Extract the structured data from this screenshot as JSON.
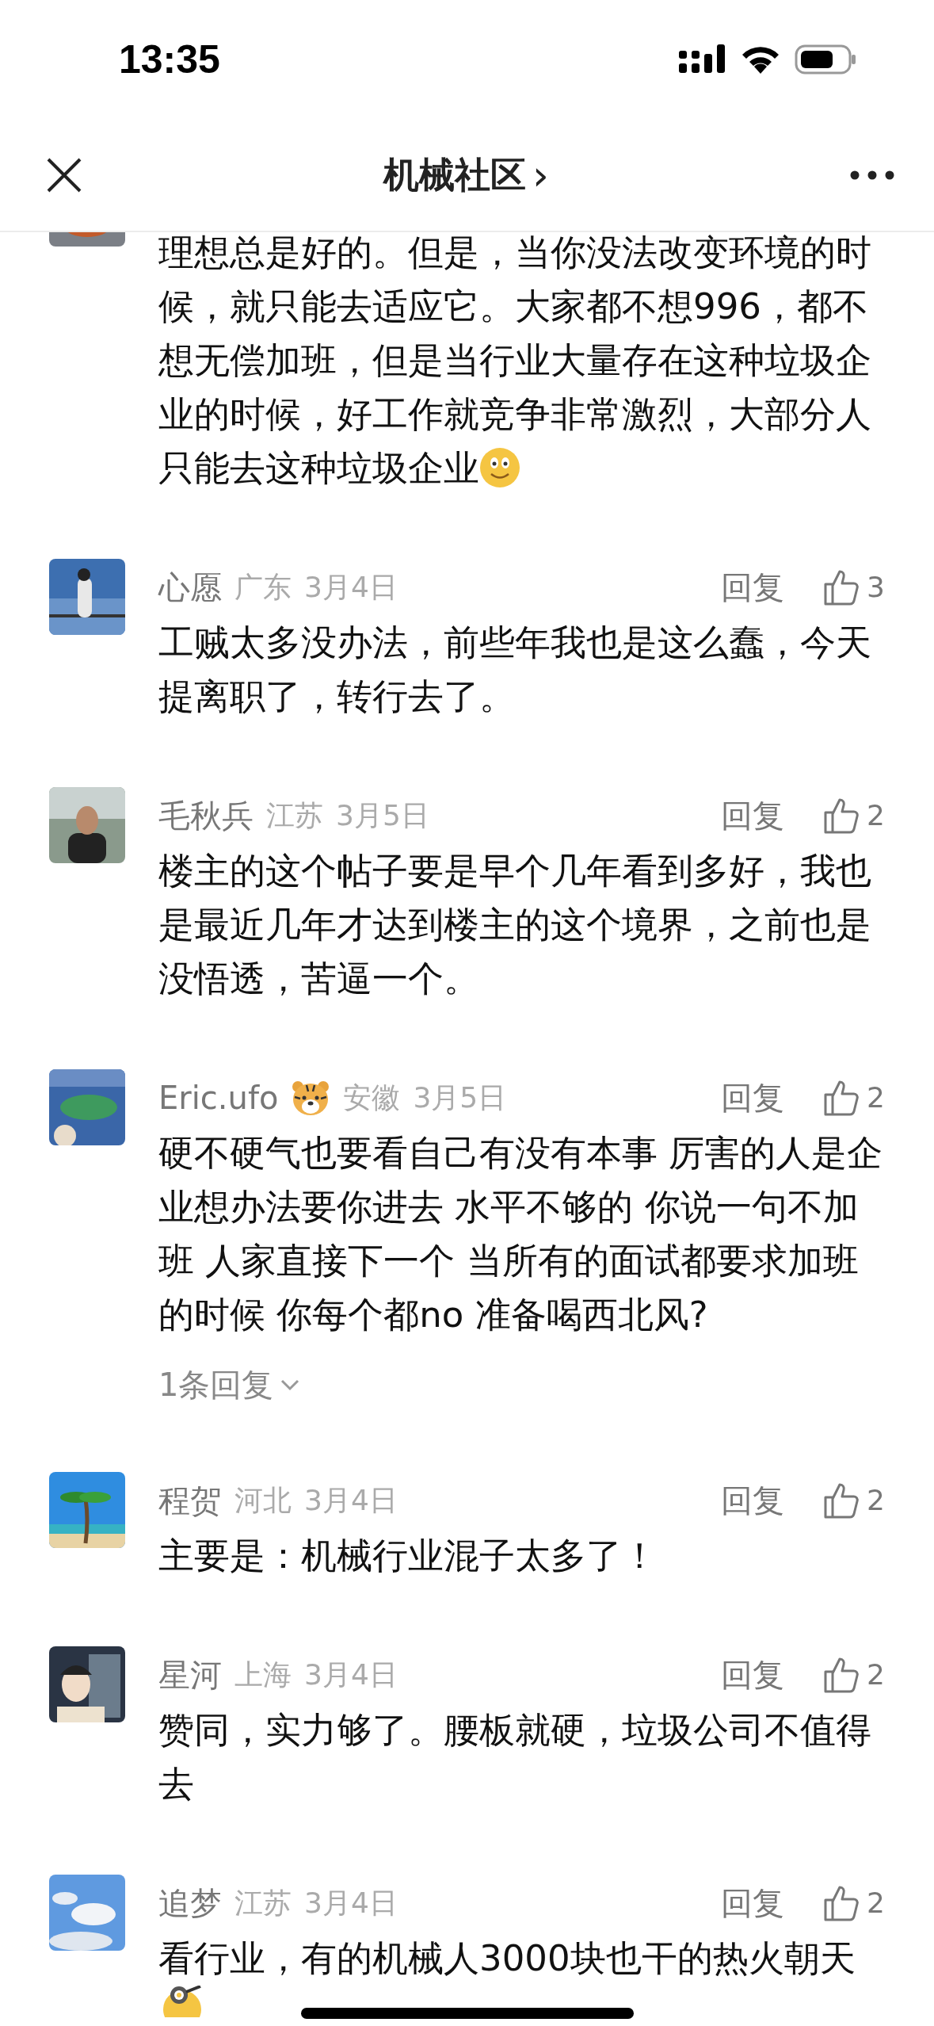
{
  "status_bar": {
    "time": "13:35"
  },
  "header": {
    "title": "机械社区",
    "chevron": "›"
  },
  "comments": [
    {
      "kind": "partial",
      "text": "理想总是好的。但是，当你没法改变环境的时候，就只能去适应它。大家都不想996，都不想无偿加班，但是当行业大量存在这种垃圾企业的时候，好工作就竞争非常激烈，大部分人只能去这种垃圾企业",
      "emoji_after_text": true
    },
    {
      "kind": "full",
      "name": "心愿",
      "region": "广东",
      "date": "3月4日",
      "reply": "回复",
      "likes": "3",
      "text": "工贼太多没办法，前些年我也是这么蠢，今天提离职了，转行去了。"
    },
    {
      "kind": "full",
      "name": "毛秋兵",
      "region": "江苏",
      "date": "3月5日",
      "reply": "回复",
      "likes": "2",
      "text": "楼主的这个帖子要是早个几年看到多好，我也是最近几年才达到楼主的这个境界，之前也是没悟透，苦逼一个。"
    },
    {
      "kind": "full",
      "name": "Eric.ufo",
      "emoji_after_name": true,
      "region": "安徽",
      "date": "3月5日",
      "reply": "回复",
      "likes": "2",
      "text": "硬不硬气也要看自己有没有本事 厉害的人是企业想办法要你进去 水平不够的 你说一句不加班 人家直接下一个 当所有的面试都要求加班的时候 你每个都no 准备喝西北风?",
      "replies_link": "1条回复"
    },
    {
      "kind": "full",
      "name": "程贺",
      "region": "河北",
      "date": "3月4日",
      "reply": "回复",
      "likes": "2",
      "text": "主要是：机械行业混子太多了！"
    },
    {
      "kind": "full",
      "name": "星河",
      "region": "上海",
      "date": "3月4日",
      "reply": "回复",
      "likes": "2",
      "text": "赞同，实力够了。腰板就硬，垃圾公司不值得去"
    },
    {
      "kind": "full",
      "name": "追梦",
      "region": "江苏",
      "date": "3月4日",
      "reply": "回复",
      "likes": "2",
      "text": "看行业，有的机械人3000块也干的热火朝天",
      "emoji_after_text": true
    }
  ]
}
